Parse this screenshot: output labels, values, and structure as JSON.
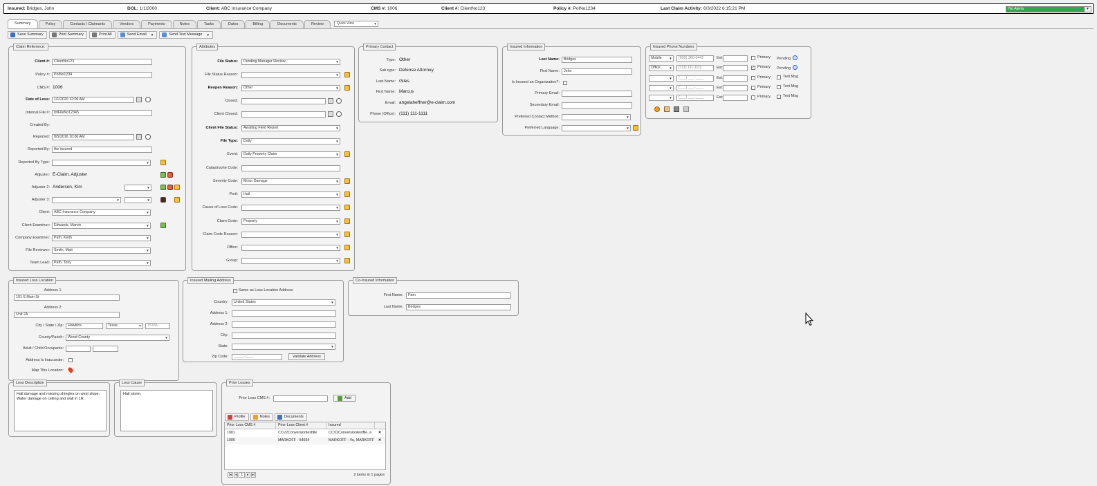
{
  "header": {
    "insured_label": "Insured:",
    "insured": "Bridges, John",
    "dol_label": "DOL:",
    "dol": "1/1/2000",
    "client_label": "Client:",
    "client": "ABC Insurance Company",
    "cms_label": "CMS #:",
    "cms": "1006",
    "client_no_label": "Client #:",
    "client_no": "ClientNo123",
    "policy_label": "Policy #:",
    "policy": "PolNo1234",
    "activity_label": "Last Claim Activity:",
    "activity": "6/3/2022 6:15:21 PM",
    "alert": "No Alerts"
  },
  "tabs": [
    "Summary",
    "Policy",
    "Contacts / Claimants",
    "Vendors",
    "Payments",
    "Notes",
    "Tasks",
    "Dates",
    "Billing",
    "Documents",
    "Review"
  ],
  "quick_view": "Quick View",
  "toolbar": {
    "save": "Save Summary",
    "print": "Print Summary",
    "print_all": "Print All",
    "email": "Send Email",
    "text": "Send Text Message"
  },
  "claim_ref": {
    "legend": "Claim Reference:",
    "client_no_label": "Client #:",
    "client_no": "ClientNo123",
    "policy_label": "Policy #:",
    "policy": "PolNo1234",
    "cms_label": "CMS #:",
    "cms": "1006",
    "dol_label": "Date of Loss:",
    "dol": "1/1/2020 12:00 AM",
    "internal_label": "Internal File #:",
    "internal": "IntFileNo12345",
    "created_label": "Created By:",
    "reported_label": "Reported:",
    "reported": "8/5/2016 10:00 AM",
    "reported_by_label": "Reported By:",
    "reported_by": "the insured",
    "reported_type_label": "Reported By Type:",
    "adjuster_label": "Adjuster:",
    "adjuster": "E-Claim, Adjuster",
    "adjuster2_label": "Adjuster 2:",
    "adjuster2": "Anderson, Kim",
    "adjuster3_label": "Adjuster 3:",
    "client_label": "Client:",
    "client": "ABC Insurance Company",
    "client_examiner_label": "Client Examiner:",
    "client_examiner": "Edwards, Marvin",
    "company_examiner_label": "Company Examiner:",
    "company_examiner": "Path, Keith",
    "file_reviewer_label": "File Reviewer:",
    "file_reviewer": "Smith, Matt",
    "team_lead_label": "Team Lead:",
    "team_lead": "Path, Tony"
  },
  "attributes": {
    "legend": "Attributes",
    "file_status_label": "File Status:",
    "file_status": "Pending Manager Review",
    "file_status_reason_label": "File Status Reason:",
    "reopen_label": "Reopen Reason:",
    "reopen": "Other",
    "closed_label": "Closed:",
    "client_closed_label": "Client Closed:",
    "client_file_status_label": "Client File Status:",
    "client_file_status": "Awaiting Field Report",
    "file_type_label": "File Type:",
    "file_type": "Daily",
    "event_label": "Event:",
    "event": "Daily Property Claim",
    "catastrophe_label": "Catastrophe Code:",
    "severity_label": "Severity Code:",
    "severity": "Minor Damage",
    "peril_label": "Peril:",
    "peril": "Hail",
    "cause_label": "Cause of Loss Code:",
    "claim_code_label": "Claim Code:",
    "claim_code": "Property",
    "claim_code_reason_label": "Claim Code Reason:",
    "office_label": "Office:",
    "group_label": "Group:"
  },
  "primary_contact": {
    "legend": "Primary Contact",
    "type_label": "Type:",
    "type": "Other",
    "subtype_label": "Sub-type:",
    "subtype": "Defense Attorney",
    "last_label": "Last Name:",
    "last": "Giles",
    "first_label": "First Name:",
    "first": "Marcus",
    "email_label": "Email:",
    "email": "angelaheffner@e-claim.com",
    "phone_label": "Phone (Office):",
    "phone": "(111) 111-1111"
  },
  "insured_info": {
    "legend": "Insured Information",
    "last_label": "Last Name:",
    "last": "Bridges",
    "first_label": "First Name:",
    "first": "John",
    "org_label": "Is Insured an Organization?:",
    "primary_email_label": "Primary Email:",
    "secondary_email_label": "Secondary Email:",
    "contact_method_label": "Preferred Contact Method:",
    "language_label": "Preferred Language:"
  },
  "phones": {
    "legend": "Insured Phone Numbers",
    "ext": "Ext:",
    "primary": "Primary",
    "text": "Text Msg",
    "pending": "Pending",
    "rows": [
      {
        "type": "Mobile",
        "number": "(903) 360-0442"
      },
      {
        "type": "Office",
        "number": "(111) 111-1111"
      },
      {
        "type": "",
        "number": "(___) ___-____"
      },
      {
        "type": "",
        "number": "(___) ___-____"
      },
      {
        "type": "",
        "number": "(___) ___-____"
      }
    ]
  },
  "loss_location": {
    "legend": "Insured Loss Location",
    "addr1_label": "Address 1:",
    "addr1": "101 S Main St",
    "addr2_label": "Address 2:",
    "addr2": "Unit 2A",
    "city_label": "City / State / Zip:",
    "city": "Hawkins",
    "state": "Texas",
    "zip": "75765-",
    "county_label": "County/Parish:",
    "county": "Wood County",
    "occupants_label": "Adult / Child Occupants:",
    "inaccurate_label": "Address Is Inaccurate:",
    "map_label": "Map This Location:"
  },
  "mailing": {
    "legend": "Insured Mailing Address",
    "same_label": "Same as Loss Location Address",
    "country_label": "Country:",
    "country": "United States",
    "addr1_label": "Address 1:",
    "addr2_label": "Address 2:",
    "city_label": "City:",
    "state_label": "State:",
    "zip_label": "Zip Code:",
    "zip": "_____-____",
    "validate": "Validate Address"
  },
  "co_insured": {
    "legend": "Co-Insured Information",
    "first_label": "First Name:",
    "first": "Pam",
    "last_label": "Last Name:",
    "last": "Bridges"
  },
  "loss_description": {
    "legend": "Loss Description",
    "text": "Hail damage and missing shingles on west slope. Water damage on ceiling and wall in LR."
  },
  "loss_cause": {
    "legend": "Loss Cause",
    "text": "Hail storm."
  },
  "prior_losses": {
    "legend": "Prior Losses",
    "cms_label": "Prior Loss CMS #:",
    "add": "Add",
    "tabs": [
      "Profile",
      "Notes",
      "Documents"
    ],
    "columns": [
      "Prior Loss CMS #",
      "Prior Loss Client #",
      "Insured"
    ],
    "rows": [
      {
        "cms": "1001",
        "client": "CCV2Conversiontestfile",
        "insured": "CCV2Conversiontestfile, a"
      },
      {
        "cms": "1005",
        "client": "MARKOFF - 54654",
        "insured": "MARKOFF - Vu, MARKOFF"
      }
    ],
    "page": "1",
    "summary": "2 items in 1 pages"
  }
}
